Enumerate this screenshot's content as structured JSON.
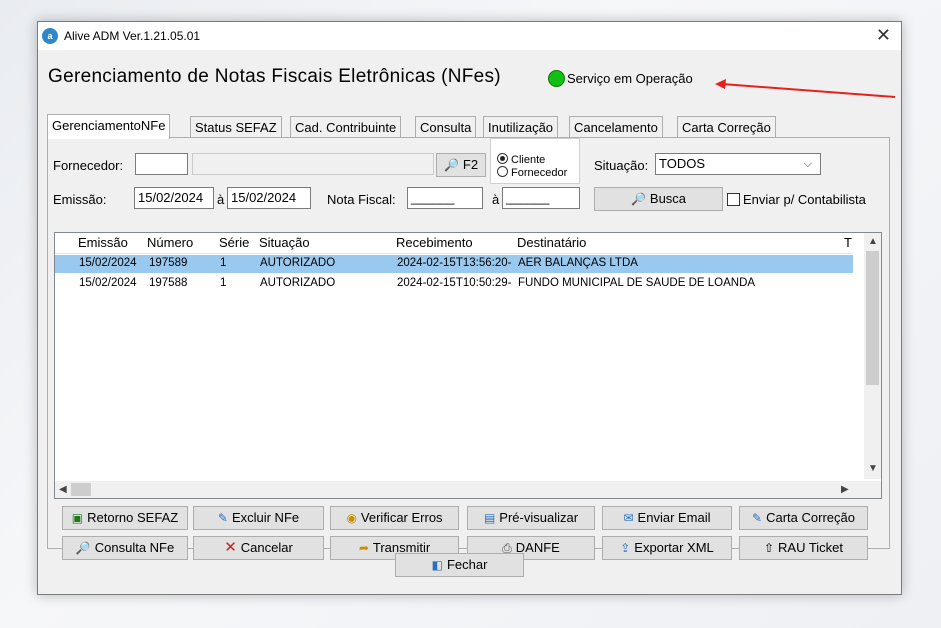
{
  "window": {
    "title": "Alive ADM Ver.1.21.05.01",
    "icon_text": "a",
    "close_label": "✕"
  },
  "header": {
    "heading": "Gerenciamento de Notas Fiscais Eletrônicas (NFes)",
    "status_text": "Serviço em Operação",
    "status_color": "#11c011"
  },
  "tabs": [
    "GerenciamentoNFe",
    "Status SEFAZ",
    "Cad. Contribuinte",
    "Consulta",
    "Inutilização",
    "Cancelamento",
    "Carta Correção"
  ],
  "filters": {
    "fornecedor_label": "Fornecedor:",
    "fornecedor_code": "",
    "fornecedor_name": "",
    "f2_label": "F2",
    "radio_cliente": "Cliente",
    "radio_fornecedor": "Fornecedor",
    "situacao_label": "Situação:",
    "situacao_value": "TODOS",
    "emissao_label": "Emissão:",
    "emissao_from": "15/02/2024",
    "a_label": "à",
    "emissao_to": "15/02/2024",
    "nota_fiscal_label": "Nota Fiscal:",
    "nota_from": "______",
    "a_label2": "à",
    "nota_to": "______",
    "busca_label": "Busca",
    "enviar_contab_label": "Enviar p/ Contabilista"
  },
  "table": {
    "columns": [
      "Emissão",
      "Número",
      "Série",
      "Situação",
      "Recebimento",
      "Destinatário",
      "T"
    ],
    "rows": [
      [
        "15/02/2024",
        "197589",
        "1",
        "AUTORIZADO",
        "2024-02-15T13:56:20-",
        "AER BALANÇAS LTDA"
      ],
      [
        "15/02/2024",
        "197588",
        "1",
        "AUTORIZADO",
        "2024-02-15T10:50:29-",
        "FUNDO MUNICIPAL DE SAUDE DE LOANDA"
      ]
    ],
    "selected_row": 0,
    "selection_color": "#99c9ef"
  },
  "actions": {
    "retorno_sefaz": "Retorno SEFAZ",
    "excluir_nfe": "Excluir NFe",
    "verificar_erros": "Verificar Erros",
    "pre_visualizar": "Pré-visualizar",
    "enviar_email": "Enviar Email",
    "carta_correcao": "Carta Correção",
    "consulta_nfe": "Consulta NFe",
    "cancelar": "Cancelar",
    "transmitir": "Transmitir",
    "danfe": "DANFE",
    "exportar_xml": "Exportar XML",
    "rau_ticket": "RAU Ticket",
    "fechar": "Fechar"
  },
  "annotation_color": "#e8201c"
}
